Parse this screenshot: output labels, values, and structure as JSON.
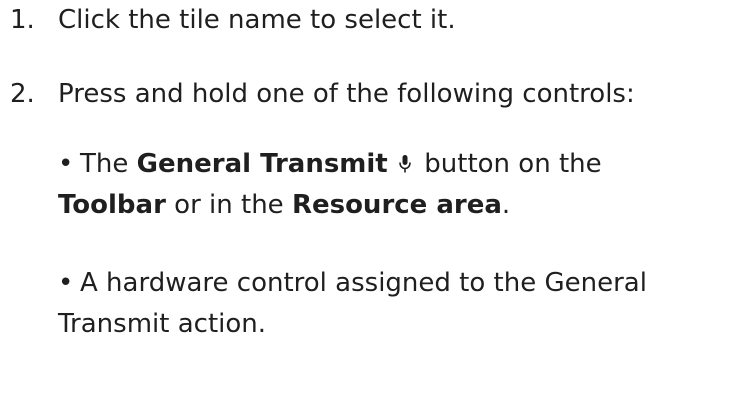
{
  "steps": [
    {
      "number": "1.",
      "text": "Click the tile name to select it."
    },
    {
      "number": "2.",
      "text": "Press and hold one of the following controls:"
    }
  ],
  "bullets": [
    {
      "marker": "•",
      "the": "The",
      "button_name": "General Transmit",
      "icon": "microphone-icon",
      "after_icon": "button on the",
      "toolbar": "Toolbar",
      "or_in_the": "or in the",
      "resource_area": "Resource area",
      "period": "."
    },
    {
      "marker": "•",
      "text": "A hardware control assigned to the General Transmit action."
    }
  ],
  "colors": {
    "text": "#1f1f1f"
  }
}
